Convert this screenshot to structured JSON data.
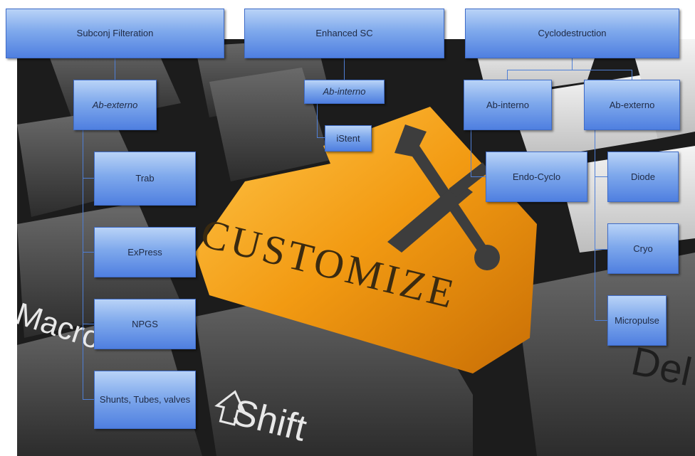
{
  "background": {
    "key_label": "CUSTOMIZE",
    "left_key_label": "Macro",
    "bottom_key_label": "Shift",
    "right_key_label": "Del"
  },
  "nodes": {
    "subconj_filteration": "Subconj Filteration",
    "enhanced_sc": "Enhanced SC",
    "cyclodestruction": "Cyclodestruction",
    "ab_externo_left": "Ab-externo",
    "ab_interno_mid": "Ab-interno",
    "istent": "iStent",
    "cyclo_ab_interno": "Ab-interno",
    "cyclo_ab_externo": "Ab-externo",
    "trab": "Trab",
    "express": "ExPress",
    "npgs": "NPGS",
    "shunts": "Shunts, Tubes, valves",
    "endo_cyclo": "Endo-Cyclo",
    "diode": "Diode",
    "cryo": "Cryo",
    "micropulse": "Micropulse"
  },
  "colors": {
    "node_top": "#b9d3f7",
    "node_bottom": "#4f7fe0",
    "connector": "#4f7fd6",
    "key_orange": "#f0a020",
    "keyboard_dark": "#3a3a3a"
  }
}
